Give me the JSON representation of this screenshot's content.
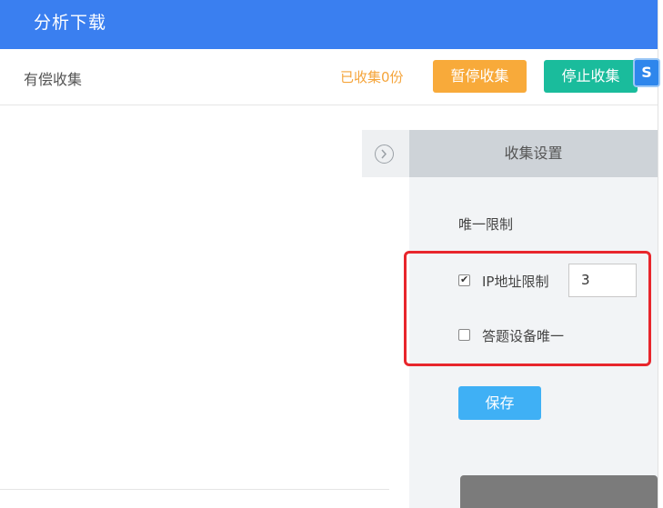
{
  "topbar": {
    "title": "分析下载"
  },
  "subbar": {
    "title": "有偿收集",
    "collect_status": "已收集0份",
    "pause_label": "暂停收集",
    "stop_label": "停止收集",
    "float_icon": "S"
  },
  "panel": {
    "header": "收集设置",
    "section_title": "唯一限制",
    "ip_limit": {
      "label": "IP地址限制",
      "checked": true,
      "value": "3"
    },
    "device_unique": {
      "label": "答题设备唯一",
      "checked": false
    },
    "save_label": "保存"
  },
  "colors": {
    "topbar": "#3a7ff0",
    "pause_button": "#f8aa3a",
    "stop_button": "#1abc9c",
    "save_button": "#3fb0f5",
    "highlight_border": "#e8262c",
    "status_text": "#f5a43a"
  },
  "icons": {
    "toggle": "chevron-right-circle-icon",
    "float": "app-logo-icon"
  }
}
